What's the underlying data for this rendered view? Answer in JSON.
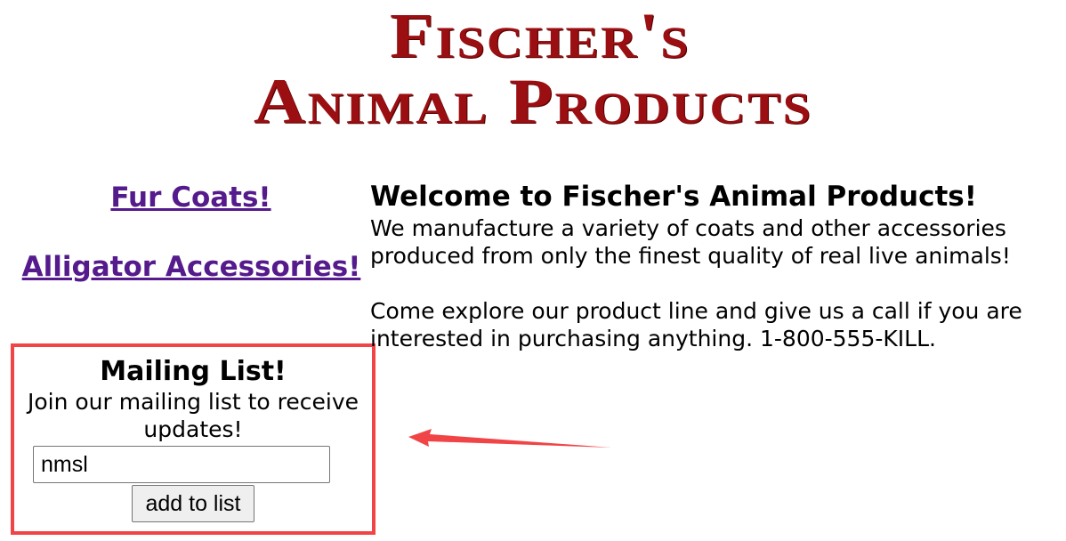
{
  "logo": {
    "line1": "Fischer's",
    "line2": "Animal Products",
    "color": "#9b0f12"
  },
  "nav": {
    "items": [
      {
        "label": "Fur Coats!"
      },
      {
        "label": "Alligator Accessories!"
      }
    ],
    "link_color": "#551a8b"
  },
  "mailing": {
    "title": "Mailing List!",
    "description": "Join our mailing list to receive updates!",
    "input_value": "nmsl",
    "button_label": "add to list",
    "highlight_color": "#f04447"
  },
  "main": {
    "heading": "Welcome to Fischer's Animal Products!",
    "paragraph1": "We manufacture a variety of coats and other accessories\nproduced from only the finest quality of real live animals!",
    "paragraph2": "Come explore our product line and give us a call if you are\ninterested in purchasing anything. 1-800-555-KILL."
  },
  "annotation": {
    "arrow_icon": "left-arrow-icon",
    "arrow_color": "#f04447"
  }
}
